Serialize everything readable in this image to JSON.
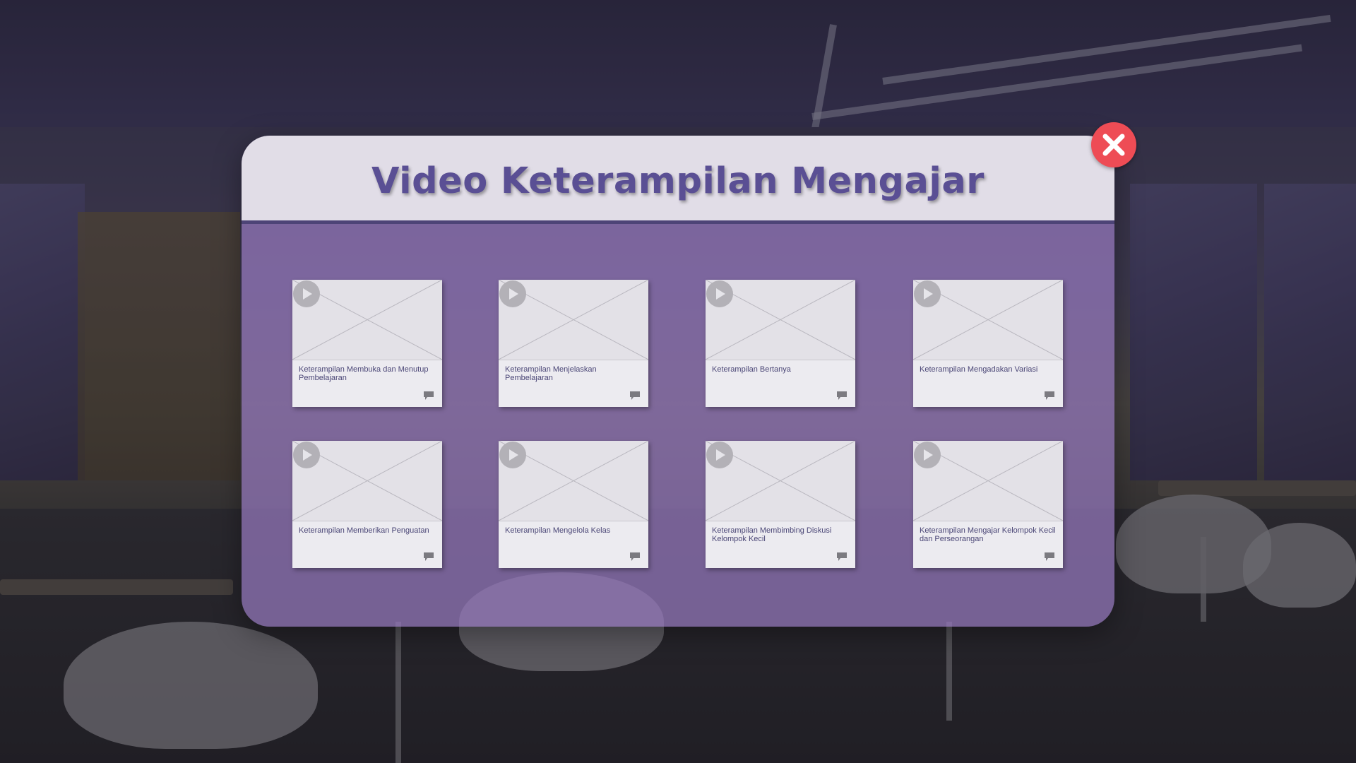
{
  "modal": {
    "title": "Video Keterampilan Mengajar"
  },
  "videos": [
    {
      "label": "Keterampilan Membuka dan Menutup Pembelajaran"
    },
    {
      "label": "Keterampilan Menjelaskan Pembelajaran"
    },
    {
      "label": "Keterampilan Bertanya"
    },
    {
      "label": "Keterampilan Mengadakan Variasi"
    },
    {
      "label": "Keterampilan Memberikan Penguatan"
    },
    {
      "label": "Keterampilan Mengelola Kelas"
    },
    {
      "label": "Keterampilan Membimbing Diskusi Kelompok Kecil"
    },
    {
      "label": "Keterampilan Mengajar Kelompok Kecil dan Perseorangan"
    }
  ],
  "icons": {
    "play": "play-icon",
    "comment": "comment-icon",
    "close": "close-icon"
  },
  "colors": {
    "title": "#5a4f94",
    "close": "#ee4c55",
    "panel": "#9678be"
  }
}
